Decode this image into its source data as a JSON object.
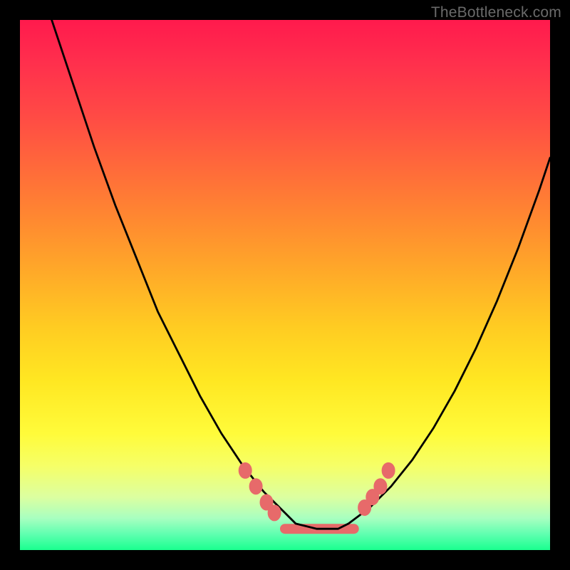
{
  "watermark": "TheBottleneck.com",
  "chart_data": {
    "type": "line",
    "title": "",
    "xlabel": "",
    "ylabel": "",
    "xlim": [
      0,
      100
    ],
    "ylim": [
      0,
      100
    ],
    "grid": false,
    "legend": false,
    "notes": "V-shaped bottleneck curve over red-to-green vertical gradient. Y is inverted visually (0 at top). Minimum plateau around x≈52–62 at y≈96. Markers cluster near the valley floor on both slopes.",
    "series": [
      {
        "name": "bottleneck-curve",
        "x": [
          6,
          10,
          14,
          18,
          22,
          26,
          30,
          34,
          38,
          42,
          46,
          50,
          52,
          56,
          60,
          62,
          66,
          70,
          74,
          78,
          82,
          86,
          90,
          94,
          98,
          100
        ],
        "values": [
          0,
          12,
          24,
          35,
          45,
          55,
          63,
          71,
          78,
          84,
          89,
          93,
          95,
          96,
          96,
          95,
          92,
          88,
          83,
          77,
          70,
          62,
          53,
          43,
          32,
          26
        ]
      }
    ],
    "markers": [
      {
        "x": 42.5,
        "y": 85
      },
      {
        "x": 44.5,
        "y": 88
      },
      {
        "x": 46.5,
        "y": 91
      },
      {
        "x": 48.0,
        "y": 93
      },
      {
        "x": 65.0,
        "y": 92
      },
      {
        "x": 66.5,
        "y": 90
      },
      {
        "x": 68.0,
        "y": 88
      },
      {
        "x": 69.5,
        "y": 85
      }
    ],
    "plateau": {
      "x0": 50,
      "x1": 63,
      "y": 96
    },
    "gradient_stops": [
      {
        "pct": 0,
        "color": "#ff1a4d"
      },
      {
        "pct": 50,
        "color": "#ffcc22"
      },
      {
        "pct": 80,
        "color": "#fffb3a"
      },
      {
        "pct": 100,
        "color": "#1aff8f"
      }
    ]
  }
}
